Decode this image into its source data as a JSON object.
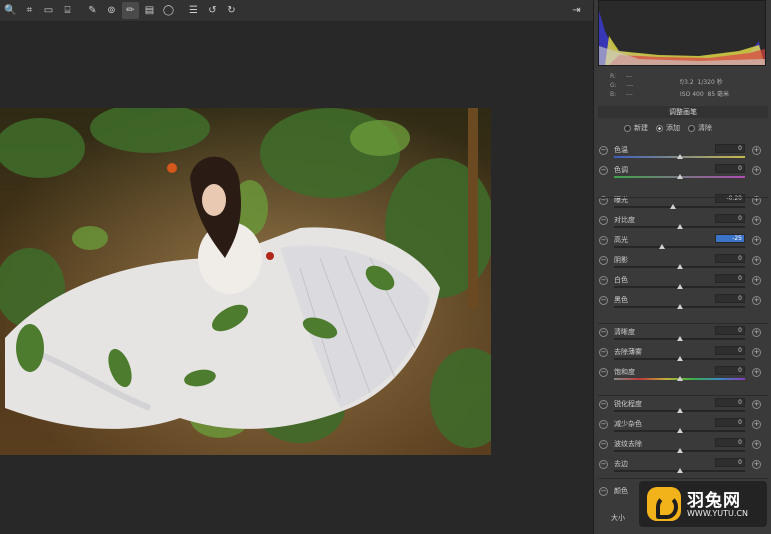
{
  "toolbar": {
    "tools": [
      {
        "name": "zoom-icon",
        "glyph": "🔍"
      },
      {
        "name": "crop-icon",
        "glyph": "⌗"
      },
      {
        "name": "straighten-icon",
        "glyph": "▭"
      },
      {
        "name": "transform-icon",
        "glyph": "⌸"
      },
      {
        "name": "spot-removal-icon",
        "glyph": "✎"
      },
      {
        "name": "red-eye-icon",
        "glyph": "⊚"
      },
      {
        "name": "adjustment-brush-icon",
        "glyph": "✏"
      },
      {
        "name": "graduated-filter-icon",
        "glyph": "▤"
      },
      {
        "name": "radial-filter-icon",
        "glyph": "◯"
      },
      {
        "name": "list-icon",
        "glyph": "☰"
      },
      {
        "name": "rotate-ccw-icon",
        "glyph": "↺"
      },
      {
        "name": "rotate-cw-icon",
        "glyph": "↻"
      }
    ],
    "export_icon": "⇥"
  },
  "histogram": {
    "r_label": "R:",
    "g_label": "G:",
    "b_label": "B:",
    "r_value": "---",
    "g_value": "---",
    "b_value": "---"
  },
  "camera": {
    "aperture": "f/3.2",
    "shutter": "1/320 秒",
    "iso": "ISO 400",
    "focal": "85 毫米"
  },
  "panel": {
    "title": "调整画笔",
    "modes": [
      {
        "label": "新建",
        "selected": false
      },
      {
        "label": "添加",
        "selected": true
      },
      {
        "label": "清除",
        "selected": false
      }
    ]
  },
  "sliders": [
    {
      "label": "色温",
      "value": "0",
      "pos": 0.5
    },
    {
      "label": "色调",
      "value": "0",
      "pos": 0.5
    },
    {
      "label": "曝光",
      "value": "-0.20",
      "pos": 0.45
    },
    {
      "label": "对比度",
      "value": "0",
      "pos": 0.5
    },
    {
      "label": "高光",
      "value": "-25",
      "pos": 0.37
    },
    {
      "label": "阴影",
      "value": "0",
      "pos": 0.5
    },
    {
      "label": "白色",
      "value": "0",
      "pos": 0.5
    },
    {
      "label": "黑色",
      "value": "0",
      "pos": 0.5
    },
    {
      "label": "清晰度",
      "value": "0",
      "pos": 0.5
    },
    {
      "label": "去除薄雾",
      "value": "0",
      "pos": 0.5
    },
    {
      "label": "饱和度",
      "value": "0",
      "pos": 0.5
    },
    {
      "label": "锐化程度",
      "value": "0",
      "pos": 0.5
    },
    {
      "label": "减少杂色",
      "value": "0",
      "pos": 0.5
    },
    {
      "label": "波纹去除",
      "value": "0",
      "pos": 0.5
    },
    {
      "label": "去边",
      "value": "0",
      "pos": 0.5
    }
  ],
  "color_row": {
    "label": "颜色"
  },
  "size_label": "大小",
  "watermark": {
    "name": "羽兔网",
    "url": "WWW.YUTU.CN"
  }
}
